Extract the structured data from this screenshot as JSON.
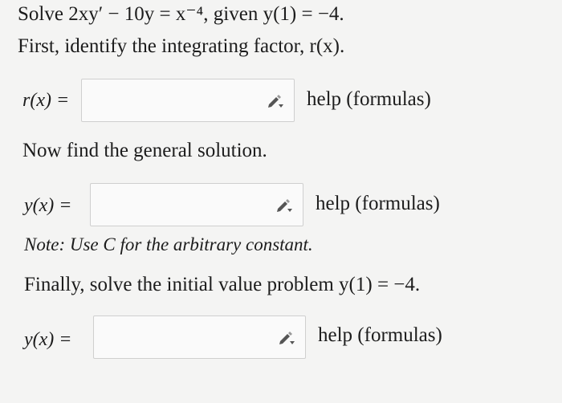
{
  "problem": {
    "statement": "Solve 2xy′ − 10y = x⁻⁴, given y(1) = −4.",
    "step1": "First, identify the integrating factor, r(x).",
    "step2": "Now find the general solution.",
    "note": "Note: Use C for the arbitrary constant.",
    "step3": "Finally, solve the initial value problem y(1) = −4."
  },
  "fields": [
    {
      "label": "r(x) =",
      "value": "",
      "help": "help (formulas)"
    },
    {
      "label": "y(x) =",
      "value": "",
      "help": "help (formulas)"
    },
    {
      "label": "y(x) =",
      "value": "",
      "help": "help (formulas)"
    }
  ],
  "icons": {
    "field_tool": "pencil-dropdown-icon"
  }
}
